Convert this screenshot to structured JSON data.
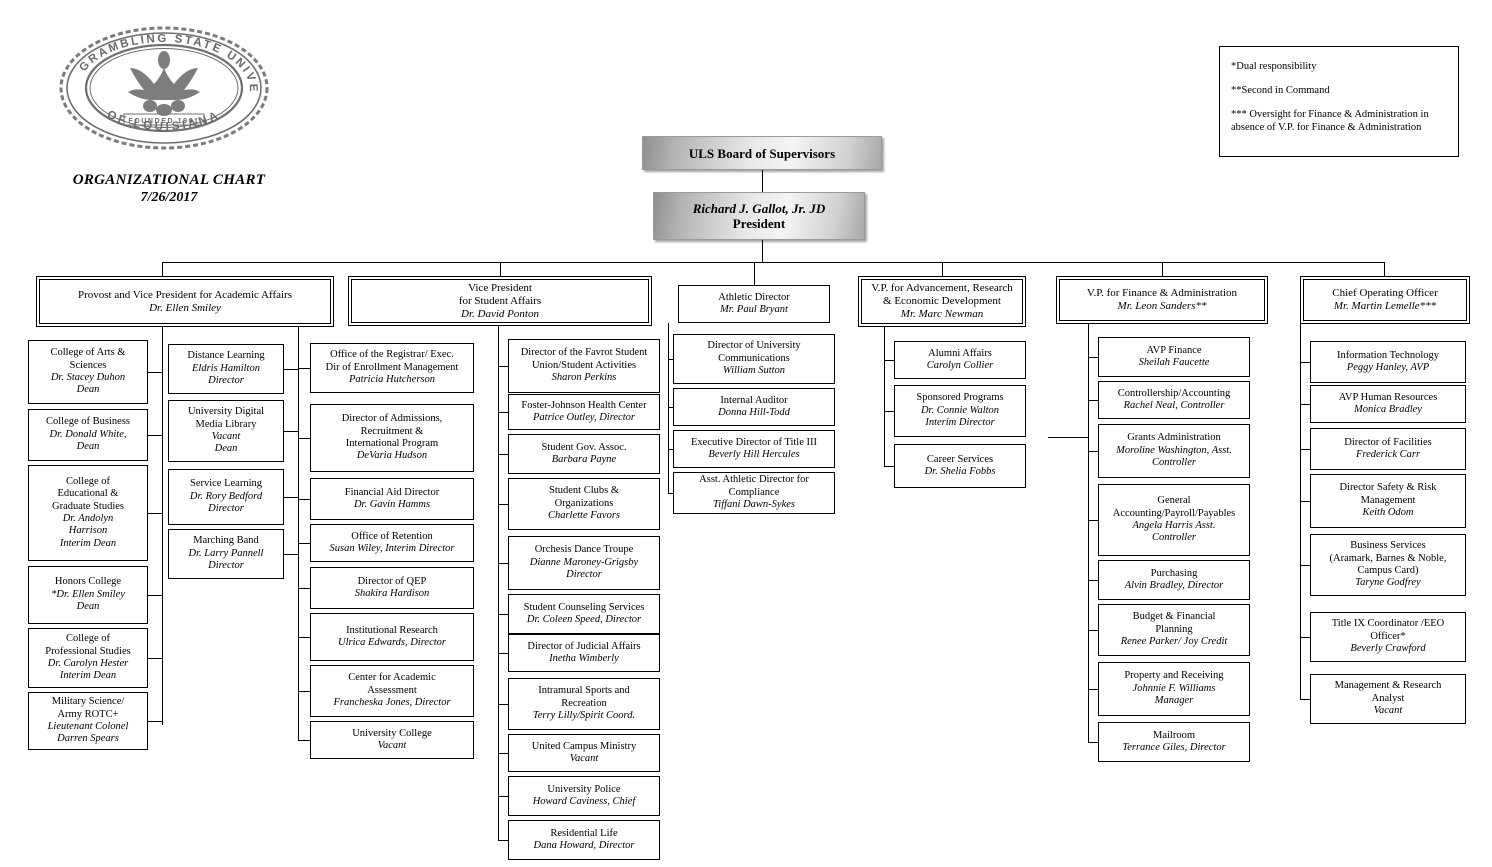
{
  "document": {
    "institution": "Grambling State University",
    "seal_text_top": "GRAMBLING  STATE  UNIVERSITY",
    "seal_text_bottom": "OF  LOUISIANA",
    "seal_founded": "FOUNDED  1901",
    "title": "ORGANIZATIONAL CHART",
    "date": "7/26/2017"
  },
  "legend": {
    "notes": [
      "*Dual responsibility",
      "**Second in Command",
      "*** Oversight for Finance & Administration in absence of V.P. for Finance & Administration"
    ]
  },
  "top": {
    "board": {
      "title": "ULS Board  of Supervisors"
    },
    "president": {
      "name": "Richard J. Gallot, Jr. JD",
      "title": "President"
    }
  },
  "divisions": [
    {
      "id": "academic-affairs",
      "title": "Provost and Vice President for Academic Affairs",
      "name": "Dr. Ellen Smiley"
    },
    {
      "id": "student-affairs",
      "title": "Vice President\nfor Student Affairs",
      "title_line1": "Vice President",
      "title_line2": "for Student Affairs",
      "name": "Dr. David Ponton"
    },
    {
      "id": "athletics",
      "title": "Athletic Director",
      "name": "Mr. Paul Bryant"
    },
    {
      "id": "advancement",
      "title_line1": "V.P. for Advancement, Research",
      "title_line2": "& Economic Development",
      "name": "Mr. Marc Newman"
    },
    {
      "id": "finance",
      "title": "V.P. for Finance & Administration",
      "name": "Mr.  Leon Sanders**"
    },
    {
      "id": "operations",
      "title": "Chief Operating Officer",
      "name": "Mr. Martin Lemelle***"
    }
  ],
  "columns": {
    "colleges": [
      {
        "title_lines": [
          "College of Arts &",
          "Sciences"
        ],
        "name_lines": [
          "Dr. Stacey Duhon",
          "Dean"
        ]
      },
      {
        "title_lines": [
          "College of Business"
        ],
        "name_lines": [
          "Dr. Donald White,",
          "Dean"
        ]
      },
      {
        "title_lines": [
          "College of",
          "Educational &",
          "Graduate Studies"
        ],
        "name_lines": [
          "Dr. Andolyn",
          "Harrison",
          "Interim Dean"
        ]
      },
      {
        "title_lines": [
          "Honors College"
        ],
        "name_lines": [
          "*Dr. Ellen Smiley",
          "Dean"
        ]
      },
      {
        "title_lines": [
          "College of",
          "Professional Studies"
        ],
        "name_lines": [
          "Dr. Carolyn Hester",
          "Interim Dean"
        ]
      },
      {
        "title_lines": [
          "Military Science/",
          "Army ROTC+"
        ],
        "name_lines": [
          "Lieutenant Colonel",
          "Darren Spears"
        ]
      }
    ],
    "academic_support": [
      {
        "title_lines": [
          "Distance Learning"
        ],
        "name_lines": [
          "Eldris Hamilton",
          "Director"
        ]
      },
      {
        "title_lines": [
          "University Digital",
          "Media Library"
        ],
        "name_lines": [
          "Vacant",
          "Dean"
        ]
      },
      {
        "title_lines": [
          "Service Learning"
        ],
        "name_lines": [
          "Dr. Rory Bedford",
          "Director"
        ]
      },
      {
        "title_lines": [
          "Marching Band"
        ],
        "name_lines": [
          "Dr. Larry Pannell",
          "Director"
        ]
      }
    ],
    "enrollment": [
      {
        "title_lines": [
          "Office of the Registrar/ Exec.",
          "Dir of Enrollment Management"
        ],
        "name_lines": [
          "Patricia Hutcherson"
        ]
      },
      {
        "title_lines": [
          "Director of Admissions,",
          "Recruitment &",
          "International Program"
        ],
        "name_lines": [
          "DeVaria Hudson"
        ]
      },
      {
        "title_lines": [
          "Financial Aid Director"
        ],
        "name_lines": [
          "Dr. Gavin Hamms"
        ]
      },
      {
        "title_lines": [
          "Office of Retention"
        ],
        "name_lines": [
          "Susan Wiley, Interim Director"
        ]
      },
      {
        "title_lines": [
          "Director of QEP"
        ],
        "name_lines": [
          "Shakira Hardison"
        ]
      },
      {
        "title_lines": [
          "Institutional Research"
        ],
        "name_lines": [
          "Ulrica Edwards, Director"
        ]
      },
      {
        "title_lines": [
          "Center for Academic",
          "Assessment"
        ],
        "name_lines": [
          "Francheska Jones, Director"
        ]
      },
      {
        "title_lines": [
          "University College"
        ],
        "name_lines": [
          "Vacant"
        ]
      }
    ],
    "student_affairs": [
      {
        "title_lines": [
          "Director of the Favrot Student",
          "Union/Student Activities"
        ],
        "name_lines": [
          "Sharon Perkins"
        ]
      },
      {
        "title_lines": [
          "Foster-Johnson Health Center"
        ],
        "name_lines": [
          "Patrice Outley, Director"
        ]
      },
      {
        "title_lines": [
          "Student Gov. Assoc."
        ],
        "name_lines": [
          "Barbara Payne"
        ]
      },
      {
        "title_lines": [
          "Student Clubs &",
          "Organizations"
        ],
        "name_lines": [
          "Charlette Favors"
        ]
      },
      {
        "title_lines": [
          "Orchesis Dance Troupe"
        ],
        "name_lines": [
          "Dianne Maroney-Grigsby",
          "Director"
        ]
      },
      {
        "title_lines": [
          "Student Counseling Services"
        ],
        "name_lines": [
          "Dr. Coleen Speed, Director"
        ]
      },
      {
        "title_lines": [
          "Director of Judicial Affairs"
        ],
        "name_lines": [
          "Inetha Wimberly"
        ]
      },
      {
        "title_lines": [
          "Intramural Sports and",
          "Recreation"
        ],
        "name_lines": [
          "Terry Lilly/Spirit Coord."
        ]
      },
      {
        "title_lines": [
          "United Campus Ministry"
        ],
        "name_lines": [
          "Vacant"
        ]
      },
      {
        "title_lines": [
          "University Police"
        ],
        "name_lines": [
          "Howard Caviness, Chief"
        ]
      },
      {
        "title_lines": [
          "Residential Life"
        ],
        "name_lines": [
          "Dana Howard, Director"
        ]
      }
    ],
    "president_direct": [
      {
        "title_lines": [
          "Director of University",
          "Communications"
        ],
        "name_lines": [
          "William Sutton"
        ]
      },
      {
        "title_lines": [
          "Internal Auditor"
        ],
        "name_lines": [
          "Donna Hill-Todd"
        ]
      },
      {
        "title_lines": [
          "Executive Director of Title III"
        ],
        "name_lines": [
          "Beverly Hill Hercules"
        ]
      },
      {
        "title_lines": [
          "Asst. Athletic Director for Compliance"
        ],
        "name_lines": [
          "Tiffani Dawn-Sykes"
        ]
      }
    ],
    "advancement": [
      {
        "title_lines": [
          "Alumni Affairs"
        ],
        "name_lines": [
          "Carolyn Collier"
        ]
      },
      {
        "title_lines": [
          "Sponsored Programs"
        ],
        "name_lines": [
          "Dr. Connie Walton",
          "Interim Director"
        ]
      },
      {
        "title_lines": [
          "Career Services"
        ],
        "name_lines": [
          "Dr. Shelia Fobbs"
        ]
      }
    ],
    "finance": [
      {
        "title_lines": [
          "AVP Finance"
        ],
        "name_lines": [
          "Sheilah Faucette"
        ]
      },
      {
        "title_lines": [
          "Controllership/Accounting"
        ],
        "name_lines": [
          "Rachel Neal, Controller"
        ]
      },
      {
        "title_lines": [
          "Grants Administration"
        ],
        "name_lines": [
          "Moroline Washington, Asst.",
          "Controller"
        ]
      },
      {
        "title_lines": [
          "General",
          "Accounting/Payroll/Payables"
        ],
        "name_lines": [
          "Angela Harris Asst.",
          "Controller"
        ]
      },
      {
        "title_lines": [
          "Purchasing"
        ],
        "name_lines": [
          "Alvin Bradley, Director"
        ]
      },
      {
        "title_lines": [
          "Budget & Financial",
          "Planning"
        ],
        "name_lines": [
          "Renee Parker/ Joy Credit"
        ]
      },
      {
        "title_lines": [
          "Property and Receiving"
        ],
        "name_lines": [
          "Johnnie F. Williams",
          "Manager"
        ]
      },
      {
        "title_lines": [
          "Mailroom"
        ],
        "name_lines": [
          "Terrance Giles, Director"
        ]
      }
    ],
    "operations": [
      {
        "title_lines": [
          "Information Technology"
        ],
        "name_lines": [
          "Peggy Hanley, AVP"
        ]
      },
      {
        "title_lines": [
          "AVP Human Resources"
        ],
        "name_lines": [
          "Monica Bradley"
        ]
      },
      {
        "title_lines": [
          "Director of Facilities"
        ],
        "name_lines": [
          "Frederick Carr"
        ]
      },
      {
        "title_lines": [
          "Director Safety & Risk",
          "Management"
        ],
        "name_lines": [
          "Keith Odom"
        ]
      },
      {
        "title_lines": [
          "Business Services",
          "(Aramark, Barnes & Noble,",
          "Campus Card)"
        ],
        "name_lines": [
          "Taryne Godfrey"
        ]
      },
      {
        "title_lines": [
          "Title IX Coordinator /EEO",
          "Officer*"
        ],
        "name_lines": [
          "Beverly Crawford"
        ]
      },
      {
        "title_lines": [
          "Management & Research",
          "Analyst"
        ],
        "name_lines": [
          "Vacant"
        ]
      }
    ]
  },
  "layout": {
    "colleges": [
      [
        28,
        340,
        120,
        64
      ],
      [
        28,
        409,
        120,
        52
      ],
      [
        28,
        465,
        120,
        96
      ],
      [
        28,
        566,
        120,
        58
      ],
      [
        28,
        628,
        120,
        60
      ],
      [
        28,
        692,
        120,
        58
      ]
    ],
    "academic_support": [
      [
        168,
        344,
        116,
        50
      ],
      [
        168,
        400,
        116,
        62
      ],
      [
        168,
        469,
        116,
        56
      ],
      [
        168,
        529,
        116,
        50
      ]
    ],
    "enrollment": [
      [
        310,
        343,
        164,
        50
      ],
      [
        310,
        404,
        164,
        68
      ],
      [
        310,
        478,
        164,
        42
      ],
      [
        310,
        524,
        164,
        38
      ],
      [
        310,
        567,
        164,
        42
      ],
      [
        310,
        613,
        164,
        48
      ],
      [
        310,
        665,
        164,
        52
      ],
      [
        310,
        721,
        164,
        38
      ]
    ],
    "student_affairs": [
      [
        508,
        339,
        152,
        54
      ],
      [
        508,
        394,
        152,
        36
      ],
      [
        508,
        434,
        152,
        40
      ],
      [
        508,
        478,
        152,
        52
      ],
      [
        508,
        536,
        152,
        54
      ],
      [
        508,
        594,
        152,
        40
      ],
      [
        508,
        634,
        152,
        38
      ],
      [
        508,
        678,
        152,
        52
      ],
      [
        508,
        734,
        152,
        38
      ],
      [
        508,
        776,
        152,
        40
      ],
      [
        508,
        820,
        152,
        40
      ]
    ],
    "president_direct": [
      [
        673,
        334,
        162,
        50
      ],
      [
        673,
        388,
        162,
        38
      ],
      [
        673,
        430,
        162,
        38
      ],
      [
        673,
        472,
        162,
        42
      ]
    ],
    "advancement": [
      [
        894,
        341,
        132,
        38
      ],
      [
        894,
        385,
        132,
        52
      ],
      [
        894,
        444,
        132,
        44
      ]
    ],
    "finance": [
      [
        1098,
        337,
        152,
        40
      ],
      [
        1098,
        381,
        152,
        38
      ],
      [
        1098,
        424,
        152,
        54
      ],
      [
        1098,
        484,
        152,
        72
      ],
      [
        1098,
        560,
        152,
        40
      ],
      [
        1098,
        604,
        152,
        52
      ],
      [
        1098,
        662,
        152,
        54
      ],
      [
        1098,
        722,
        152,
        40
      ]
    ],
    "operations": [
      [
        1310,
        341,
        156,
        42
      ],
      [
        1310,
        385,
        156,
        38
      ],
      [
        1310,
        428,
        156,
        42
      ],
      [
        1310,
        474,
        156,
        54
      ],
      [
        1310,
        534,
        156,
        62
      ],
      [
        1310,
        612,
        156,
        50
      ],
      [
        1310,
        674,
        156,
        50
      ]
    ]
  }
}
